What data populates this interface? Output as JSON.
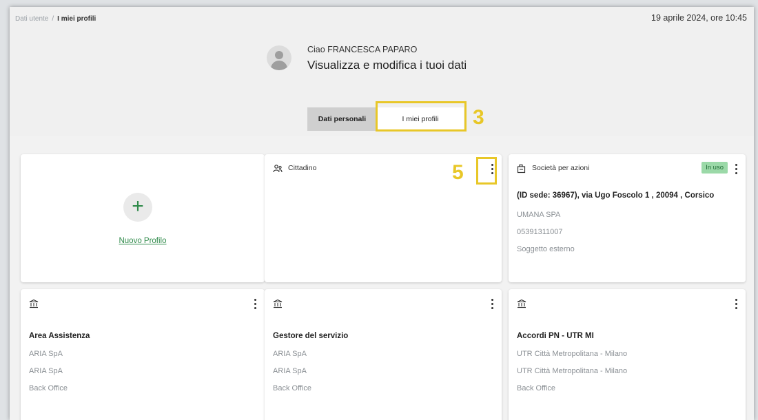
{
  "breadcrumb": {
    "parent": "Dati utente",
    "separator": "/",
    "current": "I miei profili"
  },
  "datetime": "19 aprile 2024, ore 10:45",
  "user": {
    "greeting": "Ciao FRANCESCA PAPARO",
    "subtitle": "Visualizza e modifica i tuoi dati"
  },
  "tabs": [
    {
      "label": "Dati personali",
      "active": false
    },
    {
      "label": "I miei profili",
      "active": true
    }
  ],
  "annotations": {
    "tab_marker": "3",
    "menu_marker": "5",
    "color": "#e8c728"
  },
  "new_profile": {
    "label": "Nuovo Profilo",
    "icon": "plus-icon"
  },
  "cards": [
    {
      "icon": "person-icon",
      "type": "Cittadino",
      "lines": []
    },
    {
      "icon": "company-icon",
      "type": "Società per azioni",
      "badge": "In uso",
      "title": "(ID sede: 36967), via Ugo Foscolo 1 , 20094 , Corsico",
      "lines": [
        "UMANA SPA",
        "05391311007",
        "Soggetto esterno"
      ]
    },
    {
      "icon": "institution-icon",
      "title": "Area Assistenza",
      "lines": [
        "ARIA SpA",
        "ARIA SpA",
        "Back Office"
      ]
    },
    {
      "icon": "institution-icon",
      "title": "Gestore del servizio",
      "lines": [
        "ARIA SpA",
        "ARIA SpA",
        "Back Office"
      ]
    },
    {
      "icon": "institution-icon",
      "title": "Accordi PN - UTR MI",
      "lines": [
        "UTR Città Metropolitana - Milano",
        "UTR Città Metropolitana - Milano",
        "Back Office"
      ]
    }
  ],
  "colors": {
    "accent_green": "#2f8a4a",
    "badge_bg": "#9bd9a8",
    "highlight": "#e8c728"
  }
}
